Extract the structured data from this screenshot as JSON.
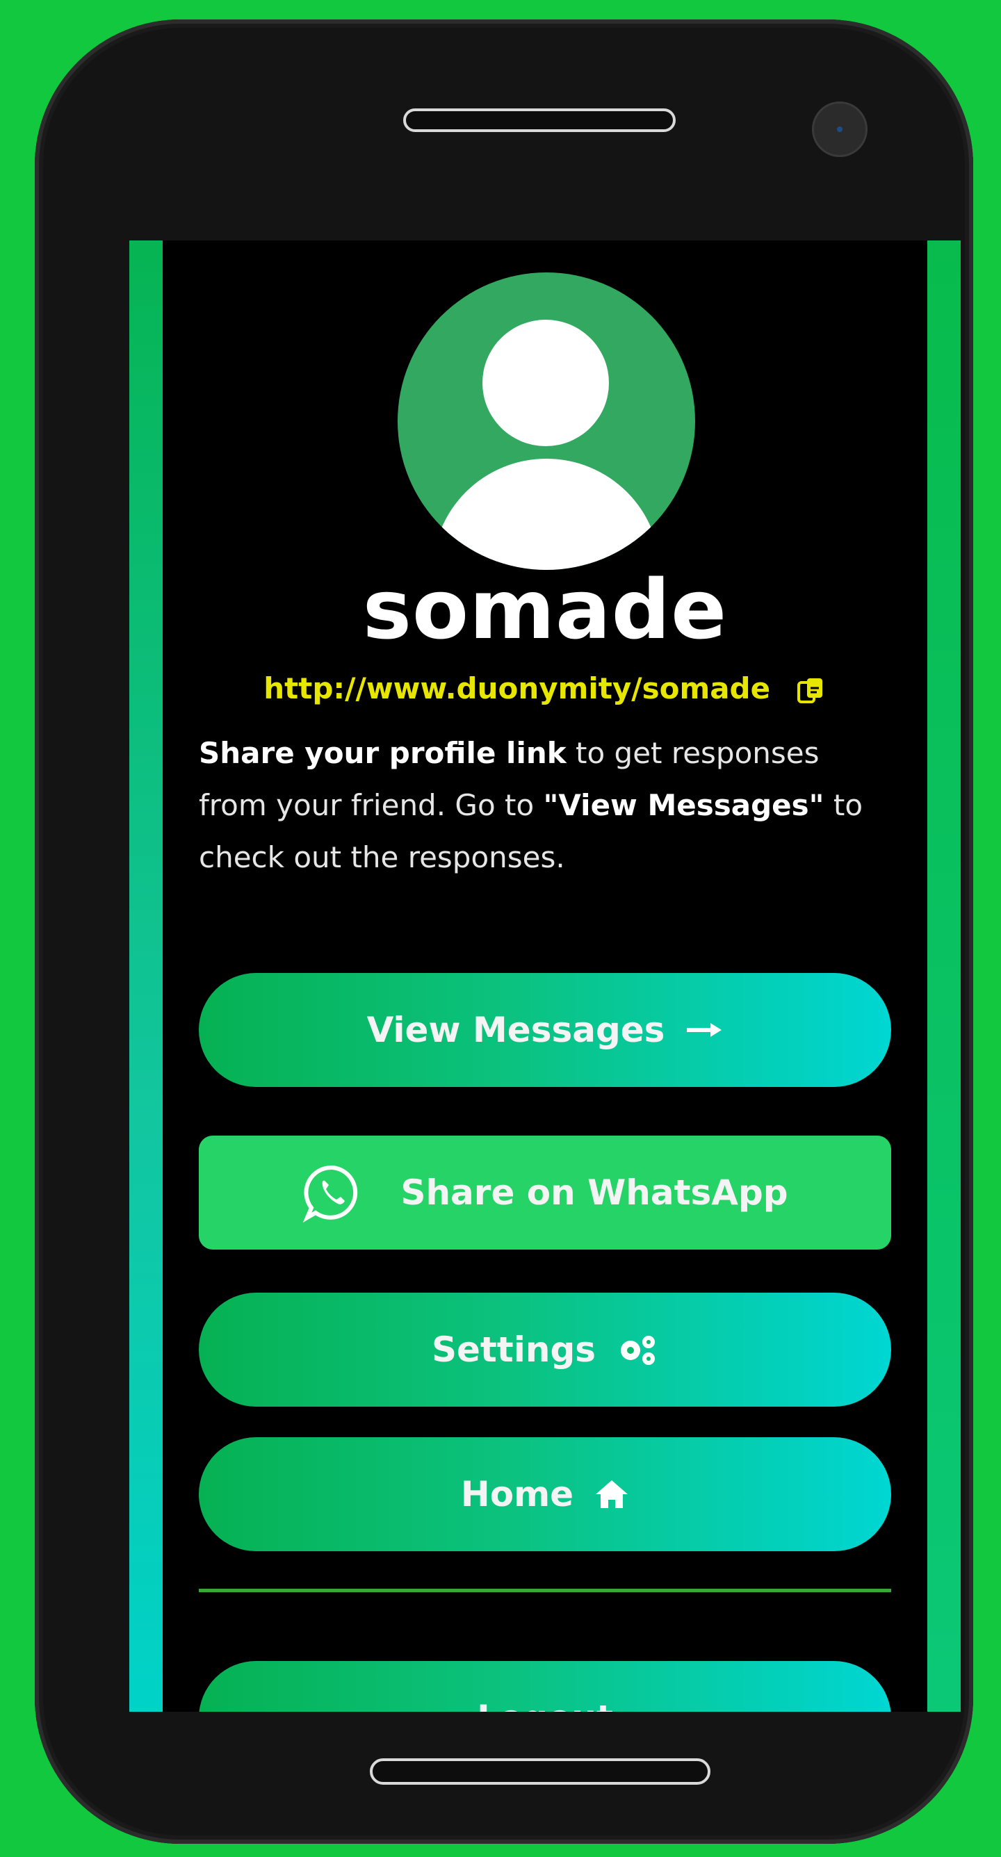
{
  "profile": {
    "username": "somade",
    "link": "http://www.duonymity/somade",
    "description_strong": "Share your profile link",
    "description_rest": " to get responses from your friend. Go to ",
    "description_quote": "\"View Messages\"",
    "description_end": " to check out the responses."
  },
  "buttons": {
    "view_messages": "View Messages",
    "share_whatsapp": "Share on WhatsApp",
    "settings": "Settings",
    "home": "Home",
    "logout": "Logout"
  },
  "icons": {
    "copy": "copy-icon",
    "arrow": "arrow-right-icon",
    "whatsapp": "whatsapp-icon",
    "settings": "gears-icon",
    "home": "home-icon",
    "avatar": "user-avatar-icon"
  },
  "colors": {
    "background": "#12c83f",
    "link": "#e6e600",
    "button_start": "#06b152",
    "button_end": "#00d6d3",
    "whatsapp": "#26d366"
  }
}
